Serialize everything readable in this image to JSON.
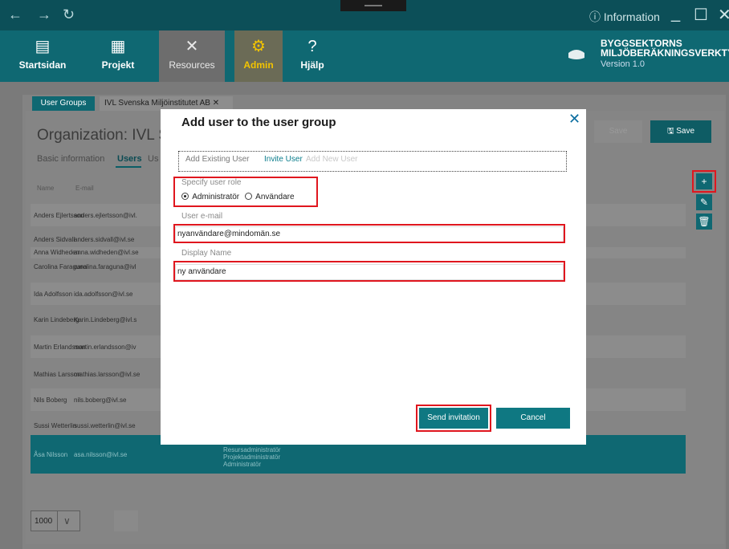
{
  "titlebar": {
    "back": "←",
    "forward": "→",
    "refresh": "↻",
    "info_label": "Information"
  },
  "nav": {
    "items": [
      {
        "label": "Startsidan",
        "icon": "home-icon"
      },
      {
        "label": "Projekt",
        "icon": "chart-icon"
      },
      {
        "label": "Resources",
        "icon": "tools-icon"
      },
      {
        "label": "Admin",
        "icon": "gear-icon"
      },
      {
        "label": "Hjälp",
        "icon": "help-icon"
      }
    ],
    "brand_line1": "BYGGSEKTORNS",
    "brand_line2": "MILJÖBERÄKNINGSVERKTYG",
    "brand_version": "Version 1.0"
  },
  "tabs": {
    "user_groups": "User Groups",
    "org_tab": "IVL Svenska Miljöinstitutet AB"
  },
  "org": {
    "title": "Organization: IVL Sve",
    "basic_info": "Basic information",
    "users": "Users",
    "us": "Us",
    "col_name": "Name",
    "col_email": "E-mail",
    "save": "Save",
    "ghost": "Save"
  },
  "users": [
    {
      "name": "Anders Ejlertsson",
      "email": "anders.ejlertsson@ivl."
    },
    {
      "name": "Anders Sidvall",
      "email": "anders.sidvall@ivl.se"
    },
    {
      "name": "Anna Widheden",
      "email": "anna.widheden@ivl.se"
    },
    {
      "name": "Carolina Faraguna",
      "email": "carolina.faraguna@ivl"
    },
    {
      "name": "Ida Adolfsson",
      "email": "ida.adolfsson@ivl.se"
    },
    {
      "name": "Karin Lindeberg",
      "email": "Karin.Lindeberg@ivl.s"
    },
    {
      "name": "Martin Erlandsson",
      "email": "martin.erlandsson@iv"
    },
    {
      "name": "Mathias Larsson",
      "email": "mathias.larsson@ivl.se"
    },
    {
      "name": "Nils Boberg",
      "email": "nils.boberg@ivl.se"
    },
    {
      "name": "Sussi Wetterlin",
      "email": "sussi.wetterlin@ivl.se"
    },
    {
      "name": "Åsa Nilsson",
      "email": "asa.nilsson@ivl.se",
      "roles": [
        "Resursadministratör",
        "Projektadministratör",
        "Administratör"
      ]
    }
  ],
  "pager": {
    "page_size": "1000"
  },
  "modal": {
    "title": "Add user to the user group",
    "close": "✕",
    "tabs": {
      "existing": "Add Existing User",
      "invite": "Invite User",
      "new": "Add New User"
    },
    "role_label": "Specify user role",
    "role_admin": "Administratör",
    "role_user": "Användare",
    "role_selected": "Administratör",
    "email_label": "User e-mail",
    "email_value": "nyanvändare@mindomän.se",
    "display_label": "Display Name",
    "display_value": "ny användare",
    "send": "Send invitation",
    "cancel": "Cancel"
  },
  "colors": {
    "teal_dark": "#0c4f58",
    "teal": "#0f6872",
    "admin_yellow": "#f3c400",
    "highlight_red": "#e0161e"
  }
}
